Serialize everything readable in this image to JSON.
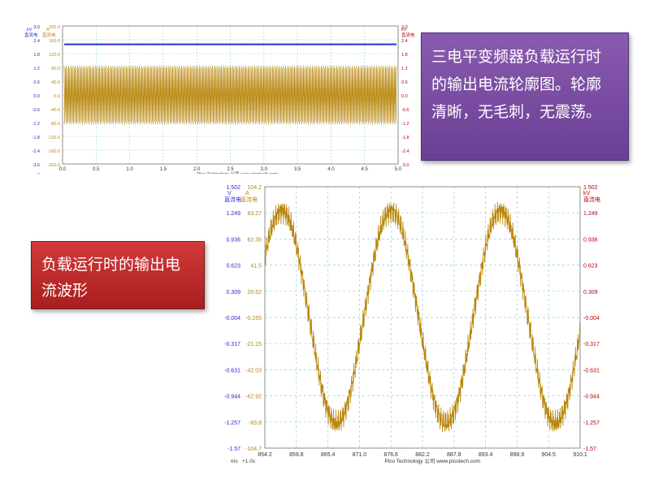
{
  "chart_data": [
    {
      "type": "line",
      "title": "",
      "left_axis_units": [
        "kV",
        "A"
      ],
      "left_axis_channels": [
        "直流电",
        "直流电"
      ],
      "right_axis_units": [
        "kV"
      ],
      "right_axis_channels": [
        "直流电"
      ],
      "y_ticks_kv": [
        "3.0",
        "2.4",
        "1.8",
        "1.2",
        "0.6",
        "0.0",
        "-0.6",
        "-1.2",
        "-1.8",
        "-2.4",
        "-3.0"
      ],
      "y_ticks_a": [
        "200.0",
        "160.0",
        "120.0",
        "80.0",
        "40.0",
        "0.0",
        "-40.0",
        "-80.0",
        "-120.0",
        "-160.0",
        "-200.0"
      ],
      "y_ticks_right": [
        "3.0",
        "2.4",
        "1.8",
        "1.2",
        "0.6",
        "0.0",
        "-0.6",
        "-1.2",
        "-1.8",
        "-2.4",
        "-3.0"
      ],
      "x_ticks": [
        "0.0",
        "0.5",
        "1.0",
        "1.5",
        "2.0",
        "2.5",
        "3.0",
        "3.5",
        "4.0",
        "4.5",
        "5.0"
      ],
      "x_unit": "s",
      "xlim": [
        0,
        5
      ],
      "ylim_kv": [
        -3.0,
        3.0
      ],
      "footer": "Pico Technology 公司   www.picotech.com",
      "series": [
        {
          "color": "#2a2ad0",
          "values_kv": [
            2.2
          ]
        },
        {
          "color": "#b8860b",
          "envelope_a": [
            -85,
            85
          ],
          "cycles": 150
        }
      ]
    },
    {
      "type": "line",
      "left_axis_units": [
        "V",
        "A"
      ],
      "left_axis_channels": [
        "直流电",
        "直流电"
      ],
      "right_axis_units": [
        "kV"
      ],
      "right_axis_channels": [
        "直流电"
      ],
      "y_ticks_v": [
        "1.502",
        "1.249",
        "0.936",
        "0.623",
        "0.309",
        "-0.004",
        "-0.317",
        "-0.631",
        "-0.944",
        "-1.257",
        "-1.57"
      ],
      "y_ticks_a": [
        "104.2",
        "83.27",
        "62.35",
        "41.5",
        "20.62",
        "-0.265",
        "-21.15",
        "-42.03",
        "-62.92",
        "-83.8",
        "-104.7"
      ],
      "y_ticks_right": [
        "1.502",
        "1.249",
        "0.936",
        "0.623",
        "0.309",
        "-0.004",
        "-0.317",
        "-0.631",
        "-0.944",
        "-1.257",
        "-1.57"
      ],
      "x_ticks": [
        "854.2",
        "859.8",
        "865.4",
        "871.0",
        "876.6",
        "882.2",
        "887.8",
        "893.4",
        "898.9",
        "904.5",
        "910.1"
      ],
      "x_unit": "ms",
      "x_offset_label": "+1.0s",
      "xlim": [
        854.2,
        910.1
      ],
      "ylim_a": [
        -104.7,
        104.2
      ],
      "footer": "Pico Technology 公司   www.picotech.com",
      "series": [
        {
          "color": "#b8860b",
          "amplitude_a": 85,
          "peaks_ms": [
            857.2,
            876.6,
            895.5
          ],
          "troughs_ms": [
            866.9,
            886.2,
            905.0
          ]
        }
      ]
    }
  ],
  "captions": {
    "purple": [
      "三电平变频器负载运行时",
      "的输出电流轮廓图。轮廓",
      "清晰，无毛刺，无震荡。"
    ],
    "red": [
      "负载运行时的输出电",
      "流波形"
    ]
  },
  "colors": {
    "purple": "#6a3f93",
    "red": "#b82323",
    "grid": "#8fd0e0",
    "signal": "#b8860b",
    "dc": "#2a2ad0"
  }
}
